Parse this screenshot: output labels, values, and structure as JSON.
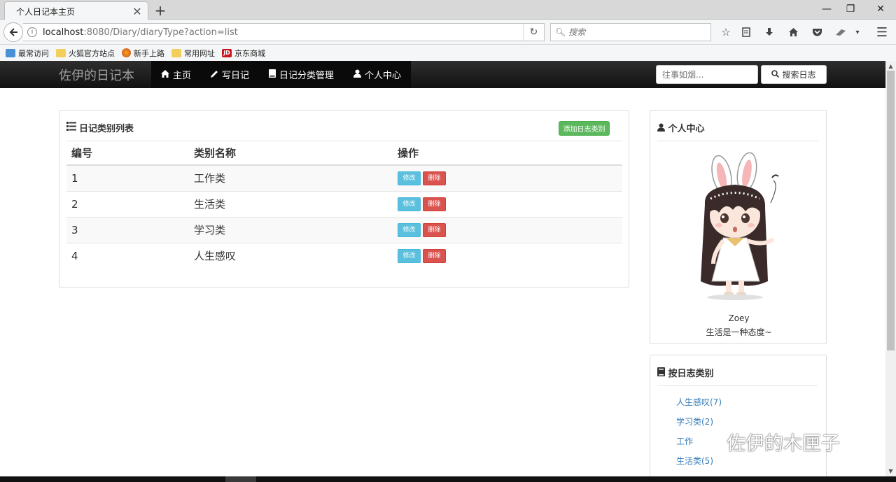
{
  "browser": {
    "tab_title": "个人日记本主页",
    "url_host": "localhost",
    "url_rest": ":8080/Diary/diaryType?action=list",
    "search_placeholder": "搜索",
    "bookmarks": [
      "最常访问",
      "火狐官方站点",
      "新手上路",
      "常用网址",
      "京东商城"
    ]
  },
  "site": {
    "brand": "佐伊的日记本",
    "nav": [
      "主页",
      "写日记",
      "日记分类管理",
      "个人中心"
    ],
    "search_placeholder": "往事如烟...",
    "search_button": "搜索日志"
  },
  "main": {
    "panel_title": "日记类别列表",
    "add_button": "添加日志类别",
    "columns": [
      "编号",
      "类别名称",
      "操作"
    ],
    "rows": [
      {
        "id": "1",
        "name": "工作类"
      },
      {
        "id": "2",
        "name": "生活类"
      },
      {
        "id": "3",
        "name": "学习类"
      },
      {
        "id": "4",
        "name": "人生感叹"
      }
    ],
    "edit_label": "修改",
    "delete_label": "删除"
  },
  "sidebar": {
    "profile_title": "个人中心",
    "nickname": "Zoey",
    "motto": "生活是一种态度~",
    "types_title": "按日志类别",
    "types": [
      "人生感叹(7)",
      "学习类(2)",
      "工作",
      "生活类(5)"
    ]
  },
  "watermark": "佐伊的木匣子",
  "colors": {
    "nav_bg": "#222222",
    "success": "#5cb85c",
    "info": "#5bc0de",
    "danger": "#d9534f",
    "link": "#337ab7"
  }
}
